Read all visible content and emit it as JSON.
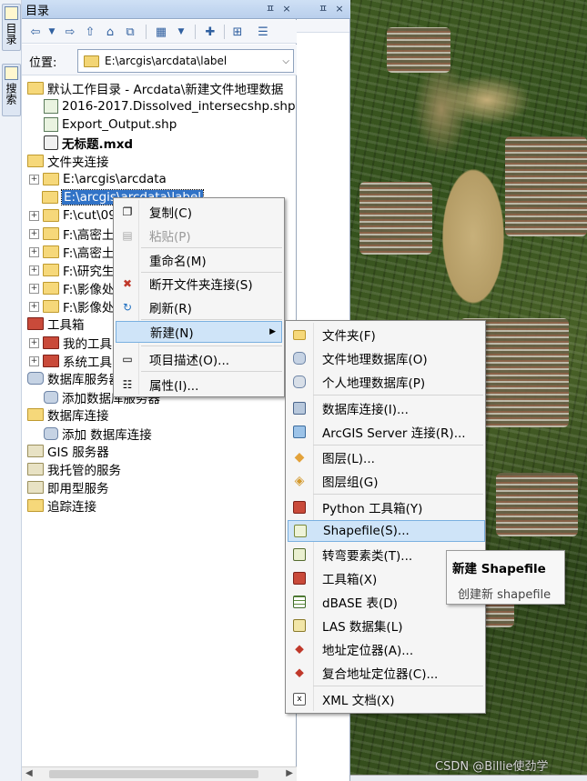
{
  "dock_tabs": [
    "目录",
    "搜索"
  ],
  "catalog": {
    "title": "目录",
    "pin": "ㅍ",
    "close": "×",
    "location_label": "位置:",
    "location_value": "E:\\arcgis\\arcdata\\label"
  },
  "tree": [
    {
      "label": "默认工作目录 - Arcdata\\新建文件地理数据",
      "icon": "folder-home-icon"
    },
    {
      "label": "2016-2017.Dissolved_intersecshp.shp",
      "icon": "shapefile-icon"
    },
    {
      "label": "Export_Output.shp",
      "icon": "shapefile-icon"
    },
    {
      "label": "无标题.mxd",
      "icon": "map-document-icon"
    },
    {
      "label": "文件夹连接",
      "icon": "folder-icon"
    },
    {
      "label": "E:\\arcgis\\arcdata",
      "icon": "folder-icon"
    },
    {
      "label": "E:\\arcgis\\arcdata\\label",
      "icon": "folder-icon"
    },
    {
      "label": "F:\\cut\\09",
      "icon": "folder-icon"
    },
    {
      "label": "F:\\高密土",
      "icon": "folder-icon"
    },
    {
      "label": "F:\\高密土",
      "icon": "folder-icon"
    },
    {
      "label": "F:\\研究生",
      "icon": "folder-icon"
    },
    {
      "label": "F:\\影像处",
      "icon": "folder-icon"
    },
    {
      "label": "F:\\影像处",
      "icon": "folder-icon"
    },
    {
      "label": "工具箱",
      "icon": "toolbox-icon"
    },
    {
      "label": "我的工具",
      "icon": "toolbox-icon"
    },
    {
      "label": "系统工具",
      "icon": "toolbox-icon"
    },
    {
      "label": "数据库服务器",
      "icon": "database-server-icon"
    },
    {
      "label": "添加数据库服务器",
      "icon": "add-database-server-icon"
    },
    {
      "label": "数据库连接",
      "icon": "database-connection-icon"
    },
    {
      "label": "添加 数据库连接",
      "icon": "add-database-connection-icon"
    },
    {
      "label": "GIS 服务器",
      "icon": "gis-server-icon"
    },
    {
      "label": "我托管的服务",
      "icon": "hosted-services-icon"
    },
    {
      "label": "即用型服务",
      "icon": "ready-services-icon"
    },
    {
      "label": "追踪连接",
      "icon": "tracking-connection-icon"
    }
  ],
  "context_menu": [
    {
      "label": "复制(C)",
      "icon": "copy-icon"
    },
    {
      "label": "粘贴(P)",
      "icon": "paste-icon",
      "disabled": true
    },
    {
      "label": "重命名(M)",
      "icon": ""
    },
    {
      "label": "断开文件夹连接(S)",
      "icon": "disconnect-folder-icon"
    },
    {
      "label": "刷新(R)",
      "icon": "refresh-icon"
    },
    {
      "label": "新建(N)",
      "icon": "",
      "submenu_arrow": "▶"
    },
    {
      "label": "项目描述(O)...",
      "icon": "item-description-icon"
    },
    {
      "label": "属性(I)...",
      "icon": "properties-icon"
    }
  ],
  "submenu": [
    {
      "label": "文件夹(F)",
      "icon": "folder-icon"
    },
    {
      "label": "文件地理数据库(O)",
      "icon": "file-geodatabase-icon"
    },
    {
      "label": "个人地理数据库(P)",
      "icon": "personal-geodatabase-icon"
    },
    {
      "label": "数据库连接(I)...",
      "icon": "database-connection-icon"
    },
    {
      "label": "ArcGIS Server 连接(R)...",
      "icon": "arcgis-server-icon"
    },
    {
      "label": "图层(L)...",
      "icon": "layer-icon"
    },
    {
      "label": "图层组(G)",
      "icon": "group-layer-icon"
    },
    {
      "label": "Python 工具箱(Y)",
      "icon": "python-toolbox-icon"
    },
    {
      "label": "Shapefile(S)...",
      "icon": "shapefile-icon"
    },
    {
      "label": "转弯要素类(T)...",
      "icon": "turn-feature-class-icon"
    },
    {
      "label": "工具箱(X)",
      "icon": "toolbox-icon"
    },
    {
      "label": "dBASE 表(D)",
      "icon": "dbase-table-icon"
    },
    {
      "label": "LAS 数据集(L)",
      "icon": "las-dataset-icon"
    },
    {
      "label": "地址定位器(A)...",
      "icon": "address-locator-icon"
    },
    {
      "label": "复合地址定位器(C)...",
      "icon": "composite-locator-icon"
    },
    {
      "label": "XML 文档(X)",
      "icon": "xml-document-icon"
    }
  ],
  "tooltip": {
    "title": "新建 Shapefile",
    "description": "创建新 shapefile"
  },
  "watermark": "CSDN @Billie使劲学"
}
